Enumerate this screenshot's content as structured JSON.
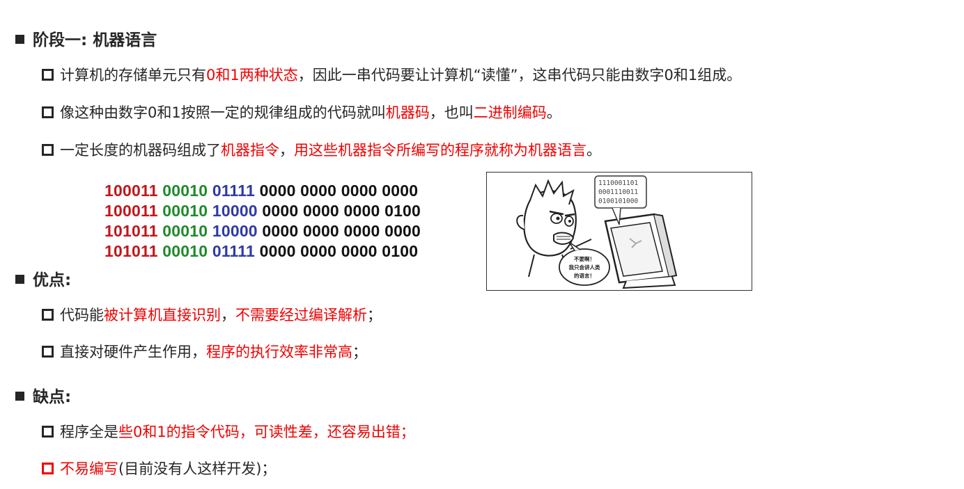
{
  "stage": {
    "heading": "阶段一: 机器语言"
  },
  "intro": [
    {
      "parts": [
        {
          "t": "计算机的存储单元只有",
          "red": false
        },
        {
          "t": "0和1两种状态",
          "red": true
        },
        {
          "t": "，因此一串代码要让计算机“读懂”，这串代码只能由数字0和1组成。",
          "red": false
        }
      ]
    },
    {
      "parts": [
        {
          "t": "像这种由数字0和1按照一定的规律组成的代码就叫",
          "red": false
        },
        {
          "t": "机器码",
          "red": true
        },
        {
          "t": "，也叫",
          "red": false
        },
        {
          "t": "二进制编码",
          "red": true
        },
        {
          "t": "。",
          "red": false
        }
      ]
    },
    {
      "parts": [
        {
          "t": "一定长度的机器码组成了",
          "red": false
        },
        {
          "t": "机器指令",
          "red": true
        },
        {
          "t": "，",
          "red": false
        },
        {
          "t": "用这些机器指令所编写的程序就称为机器语言",
          "red": true
        },
        {
          "t": "。",
          "red": false
        }
      ]
    }
  ],
  "binary": [
    [
      "100011",
      "00010",
      "01111",
      "0000 0000 0000 0000"
    ],
    [
      "100011",
      "00010",
      "10000",
      "0000 0000 0000 0100"
    ],
    [
      "101011",
      "00010",
      "10000",
      "0000 0000 0000 0000"
    ],
    [
      "101011",
      "00010",
      "01111",
      "0000 0000 0000 0100"
    ]
  ],
  "cartoon": {
    "screen_lines": [
      "1110001101",
      "0001110011",
      "0100101000"
    ],
    "bubble_lines": [
      "不要啊！",
      "我只会讲人类",
      "的语言！"
    ]
  },
  "pros": {
    "heading": "优点:",
    "items": [
      {
        "parts": [
          {
            "t": "代码能",
            "red": false
          },
          {
            "t": "被计算机直接识别",
            "red": true
          },
          {
            "t": "，",
            "red": false
          },
          {
            "t": "不需要经过编译解析",
            "red": true
          },
          {
            "t": "；",
            "red": false
          }
        ]
      },
      {
        "parts": [
          {
            "t": "直接对硬件产生作用，",
            "red": false
          },
          {
            "t": "程序的执行效率非常高",
            "red": true
          },
          {
            "t": "；",
            "red": false
          }
        ]
      }
    ]
  },
  "cons": {
    "heading": "缺点:",
    "items": [
      {
        "redbox": false,
        "parts": [
          {
            "t": "程序全是",
            "red": false
          },
          {
            "t": "些0和1的指令代码，可读性差，还容易出错；",
            "red": true
          }
        ]
      },
      {
        "redbox": true,
        "parts": [
          {
            "t": "不易编写",
            "red": true
          },
          {
            "t": "(目前没有人这样开发)；",
            "red": false
          }
        ]
      }
    ]
  },
  "colors": {
    "text": "#262626",
    "accent_red": "#f00000",
    "opcode": "#c0171c",
    "reg1": "#1f8a2b",
    "reg2": "#2e3aa6"
  }
}
